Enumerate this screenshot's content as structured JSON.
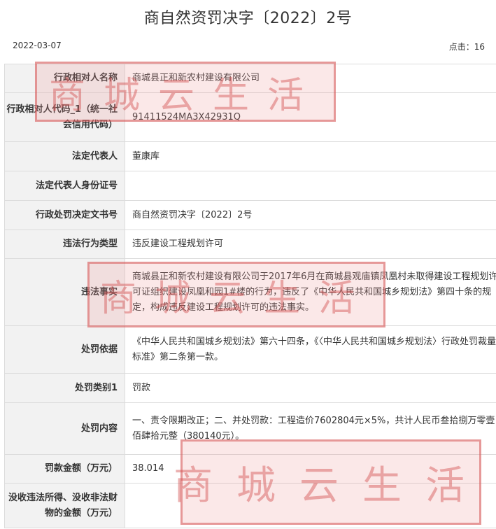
{
  "header": {
    "title": "商自然资罚决字〔2022〕2号",
    "date": "2022-03-07",
    "clicks_label": "点击：",
    "clicks_value": "16"
  },
  "rows": [
    {
      "key": "行政相对人名称",
      "value": "商城县正和新农村建设有限公司"
    },
    {
      "key": "行政相对人代码_1（统一社会信用代码）",
      "value": "91411524MA3X42931Q"
    },
    {
      "key": "法定代表人",
      "value": "董康库"
    },
    {
      "key": "法定代表人身份证号",
      "value": ""
    },
    {
      "key": "行政处罚决定文书号",
      "value": "商自然资罚决字〔2022〕2号"
    },
    {
      "key": "违法行为类型",
      "value": "违反建设工程规划许可"
    },
    {
      "key": "违法事实",
      "value": "商城县正和新农村建设有限公司于2017年6月在商城县观庙镇凤凰村未取得建设工程规划许可证组织建设凤凰和园1#楼的行为，违反了《中华人民共和国城乡规划法》第四十条的规定，构成违反建设工程规划许可的违法事实。"
    },
    {
      "key": "处罚依据",
      "value": "《中华人民共和国城乡规划法》第六十四条，《〈中华人民共和国城乡规划法〉行政处罚裁量标准》第二条第一款。"
    },
    {
      "key": "处罚类别1",
      "value": "罚款"
    },
    {
      "key": "处罚内容",
      "value": "一、责令限期改正；二、并处罚款：工程造价7602804元×5%，共计人民币叁拾捌万零壹佰肆拾元整（380140元）。"
    },
    {
      "key": "罚款金额（万元）",
      "value": "38.014"
    },
    {
      "key": "没收违法所得、没收非法财物的金额（万元）",
      "value": ""
    }
  ],
  "watermark": {
    "text": "商城云生活",
    "color": "#d65656"
  }
}
